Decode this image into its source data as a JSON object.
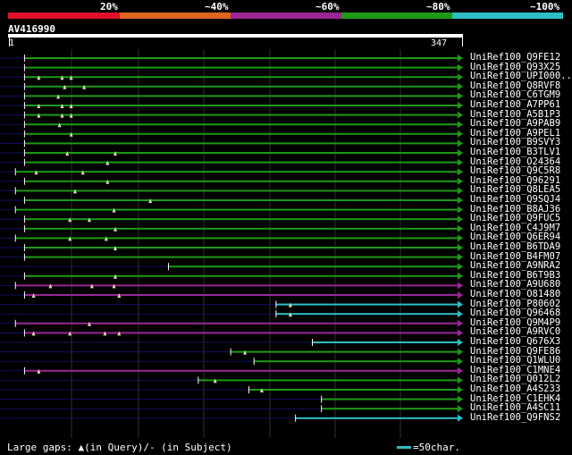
{
  "scale": {
    "segments": [
      {
        "label": "20%",
        "color": "#e0102a"
      },
      {
        "label": "~40%",
        "color": "#e0641c"
      },
      {
        "label": "~60%",
        "color": "#9a2594"
      },
      {
        "label": "~80%",
        "color": "#1d9a16"
      },
      {
        "label": "~100%",
        "color": "#2bbfc4"
      }
    ]
  },
  "query": {
    "name": "AV416990",
    "start": "1",
    "end": "347"
  },
  "colors": {
    "green": "#1d9a16",
    "purple": "#9a2594",
    "cyan": "#2bbfc4",
    "navy": "#101060",
    "tick": "#d8d8a8"
  },
  "chart_data": {
    "type": "alignment",
    "query_length": 347,
    "hits": [
      {
        "name": "UniRef100_Q9FE12",
        "color": "green",
        "start": 13,
        "end": 347,
        "gaps_query": []
      },
      {
        "name": "UniRef100_Q93X25",
        "color": "green",
        "start": 13,
        "end": 347,
        "gaps_query": []
      },
      {
        "name": "UniRef100_UPI000..",
        "color": "green",
        "start": 13,
        "end": 347,
        "gaps_query": [
          24,
          42,
          49
        ]
      },
      {
        "name": "UniRef100_Q8RVF8",
        "color": "green",
        "start": 13,
        "end": 347,
        "gaps_query": [
          44,
          59
        ]
      },
      {
        "name": "UniRef100_C6TGM9",
        "color": "green",
        "start": 13,
        "end": 347,
        "gaps_query": [
          39
        ]
      },
      {
        "name": "UniRef100_A7PP61",
        "color": "green",
        "start": 13,
        "end": 347,
        "gaps_query": [
          24,
          42,
          49
        ]
      },
      {
        "name": "UniRef100_A5B1P3",
        "color": "green",
        "start": 13,
        "end": 347,
        "gaps_query": [
          24,
          42,
          49
        ]
      },
      {
        "name": "UniRef100_A9PAB9",
        "color": "green",
        "start": 13,
        "end": 347,
        "gaps_query": [
          40
        ]
      },
      {
        "name": "UniRef100_A9PEL1",
        "color": "green",
        "start": 13,
        "end": 347,
        "gaps_query": [
          49
        ]
      },
      {
        "name": "UniRef100_B9SVY3",
        "color": "green",
        "start": 13,
        "end": 347,
        "gaps_query": []
      },
      {
        "name": "UniRef100_B3TLV1",
        "color": "green",
        "start": 13,
        "end": 347,
        "gaps_query": [
          46,
          83
        ]
      },
      {
        "name": "UniRef100_O24364",
        "color": "green",
        "start": 13,
        "end": 347,
        "gaps_query": [
          77
        ]
      },
      {
        "name": "UniRef100_Q9C5R8",
        "color": "green",
        "start": 6,
        "end": 347,
        "gaps_query": [
          22,
          58
        ]
      },
      {
        "name": "UniRef100_Q96291",
        "color": "green",
        "start": 13,
        "end": 347,
        "gaps_query": [
          77
        ]
      },
      {
        "name": "UniRef100_Q8LEA5",
        "color": "green",
        "start": 6,
        "end": 347,
        "gaps_query": [
          52
        ]
      },
      {
        "name": "UniRef100_Q9SQJ4",
        "color": "green",
        "start": 13,
        "end": 347,
        "gaps_query": [
          110
        ]
      },
      {
        "name": "UniRef100_B8AJ36",
        "color": "green",
        "start": 6,
        "end": 347,
        "gaps_query": [
          82
        ]
      },
      {
        "name": "UniRef100_Q9FUC5",
        "color": "green",
        "start": 13,
        "end": 347,
        "gaps_query": [
          48,
          63
        ]
      },
      {
        "name": "UniRef100_C4J9M7",
        "color": "green",
        "start": 13,
        "end": 347,
        "gaps_query": [
          83
        ]
      },
      {
        "name": "UniRef100_Q6ER94",
        "color": "green",
        "start": 6,
        "end": 347,
        "gaps_query": [
          48,
          76
        ]
      },
      {
        "name": "UniRef100_B6TDA9",
        "color": "green",
        "start": 13,
        "end": 347,
        "gaps_query": [
          83
        ]
      },
      {
        "name": "UniRef100_B4FM07",
        "color": "green",
        "start": 13,
        "end": 347,
        "gaps_query": []
      },
      {
        "name": "UniRef100_A9NRA2",
        "color": "green",
        "start": 124,
        "end": 347,
        "gaps_query": []
      },
      {
        "name": "UniRef100_B6T9B3",
        "color": "green",
        "start": 13,
        "end": 347,
        "gaps_query": [
          83
        ]
      },
      {
        "name": "UniRef100_A9U680",
        "color": "purple",
        "start": 6,
        "end": 347,
        "gaps_query": [
          33,
          65,
          82
        ]
      },
      {
        "name": "UniRef100_O81480",
        "color": "purple",
        "start": 13,
        "end": 347,
        "gaps_query": [
          20,
          86
        ]
      },
      {
        "name": "UniRef100_P80602",
        "color": "cyan",
        "start": 207,
        "end": 347,
        "gaps_query": [
          218
        ]
      },
      {
        "name": "UniRef100_Q96468",
        "color": "cyan",
        "start": 207,
        "end": 347,
        "gaps_query": [
          218
        ]
      },
      {
        "name": "UniRef100_Q9M4P9",
        "color": "purple",
        "start": 6,
        "end": 347,
        "gaps_query": [
          63
        ]
      },
      {
        "name": "UniRef100_A9RVC0",
        "color": "purple",
        "start": 13,
        "end": 347,
        "gaps_query": [
          20,
          48,
          75,
          86
        ]
      },
      {
        "name": "UniRef100_Q676X3",
        "color": "cyan",
        "start": 235,
        "end": 347,
        "gaps_query": []
      },
      {
        "name": "UniRef100_Q9FE86",
        "color": "green",
        "start": 172,
        "end": 347,
        "gaps_query": [
          183
        ]
      },
      {
        "name": "UniRef100_Q1WLU0",
        "color": "green",
        "start": 190,
        "end": 347,
        "gaps_query": []
      },
      {
        "name": "UniRef100_C1MNE4",
        "color": "purple",
        "start": 13,
        "end": 347,
        "gaps_query": [
          24
        ]
      },
      {
        "name": "UniRef100_Q012L2",
        "color": "green",
        "start": 147,
        "end": 347,
        "gaps_query": [
          160
        ]
      },
      {
        "name": "UniRef100_A4S233",
        "color": "green",
        "start": 186,
        "end": 347,
        "gaps_query": [
          196
        ]
      },
      {
        "name": "UniRef100_C1EHK4",
        "color": "green",
        "start": 242,
        "end": 347,
        "gaps_query": []
      },
      {
        "name": "UniRef100_A4SC11",
        "color": "green",
        "start": 242,
        "end": 347,
        "gaps_query": []
      },
      {
        "name": "UniRef100_Q9FNS2",
        "color": "cyan",
        "start": 222,
        "end": 347,
        "gaps_query": []
      }
    ]
  },
  "footer": {
    "gaps_text": "Large gaps: ▲(in Query)/- (in Subject)",
    "legend_text": "=50char."
  }
}
